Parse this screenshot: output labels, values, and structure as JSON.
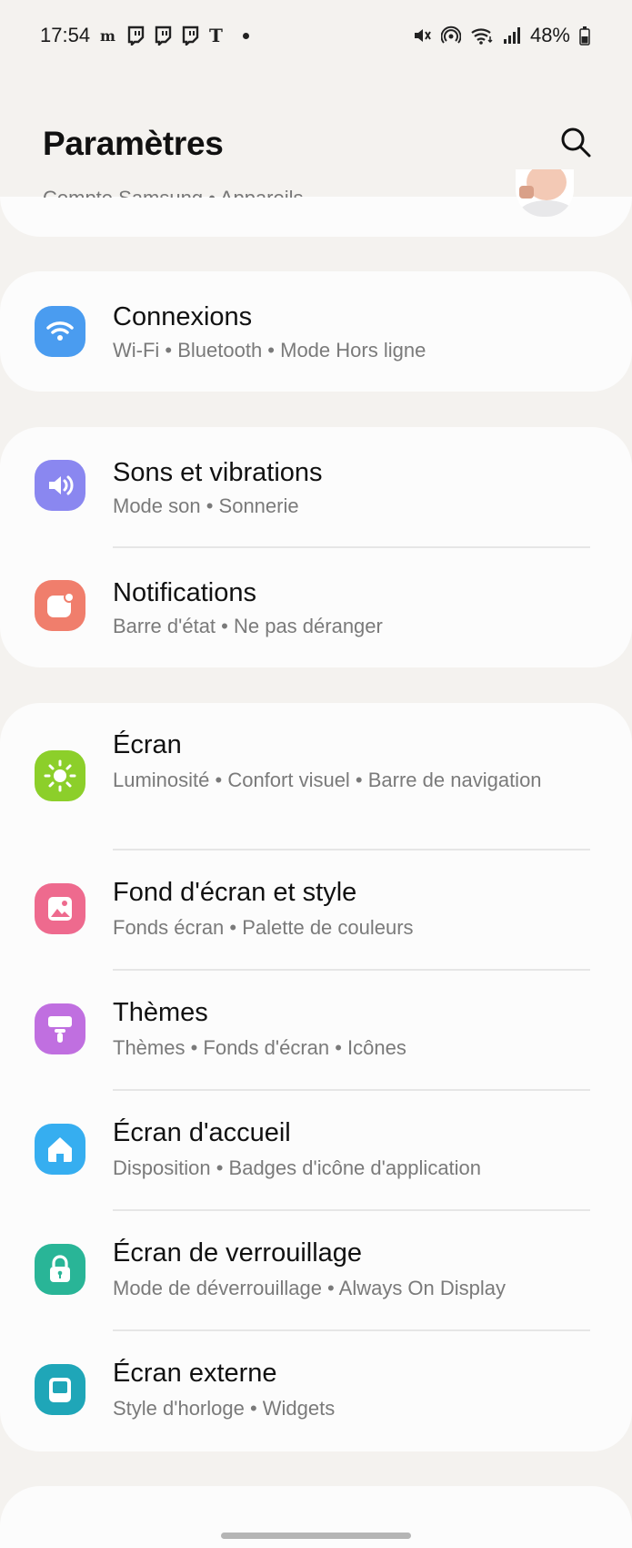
{
  "status_bar": {
    "time": "17:54",
    "battery": "48%",
    "left_icons": [
      "lemonde-icon",
      "twitch-icon",
      "twitch-icon",
      "twitch-icon",
      "nyt-icon"
    ],
    "right_icons": [
      "mute-icon",
      "hotspot-icon",
      "wifi-icon",
      "signal-icon",
      "battery-icon"
    ]
  },
  "header": {
    "title": "Paramètres",
    "search_icon": "search-icon"
  },
  "account": {
    "subtitle": "Compte Samsung  •  Appareils"
  },
  "sections": [
    {
      "items": [
        {
          "title": "Connexions",
          "subtitle": "Wi-Fi  •  Bluetooth  •  Mode Hors ligne",
          "icon": "wifi-icon",
          "color": "#4a9cf0"
        }
      ]
    },
    {
      "items": [
        {
          "title": "Sons et vibrations",
          "subtitle": "Mode son  •  Sonnerie",
          "icon": "volume-icon",
          "color": "#8a87f0"
        },
        {
          "title": "Notifications",
          "subtitle": "Barre d'état  •  Ne pas déranger",
          "icon": "notification-icon",
          "color": "#f07e6c"
        }
      ]
    },
    {
      "items": [
        {
          "title": "Écran",
          "subtitle": "Luminosité  •  Confort visuel  •  Barre de navigation",
          "icon": "brightness-icon",
          "color": "#8ccf2a"
        },
        {
          "title": "Fond d'écran et style",
          "subtitle": "Fonds écran  •  Palette de couleurs",
          "icon": "wallpaper-icon",
          "color": "#ee6a8e"
        },
        {
          "title": "Thèmes",
          "subtitle": "Thèmes  •  Fonds d'écran  •  Icônes",
          "icon": "brush-icon",
          "color": "#c06fe0"
        },
        {
          "title": "Écran d'accueil",
          "subtitle": "Disposition  •  Badges d'icône d'application",
          "icon": "home-icon",
          "color": "#36aef0"
        },
        {
          "title": "Écran de verrouillage",
          "subtitle": "Mode de déverrouillage  •  Always On Display",
          "icon": "lock-icon",
          "color": "#29b597"
        },
        {
          "title": "Écran externe",
          "subtitle": "Style d'horloge  •  Widgets",
          "icon": "cover-screen-icon",
          "color": "#1fa6b8"
        }
      ]
    }
  ]
}
